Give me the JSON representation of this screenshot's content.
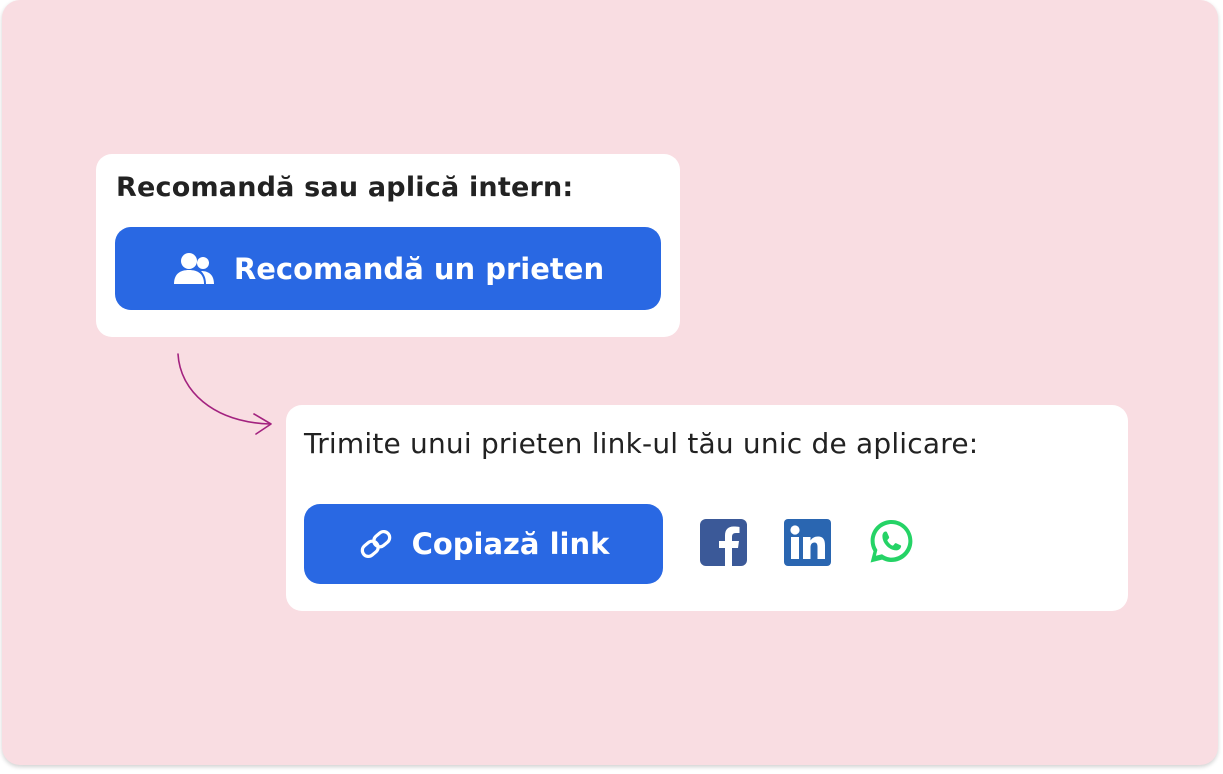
{
  "referral_card": {
    "heading": "Recomandă sau aplică intern:",
    "button_label": "Recomandă un prieten",
    "button_icon": "users-icon"
  },
  "share_card": {
    "heading": "Trimite unui prieten link-ul tău unic de aplicare:",
    "copy_button_label": "Copiază link",
    "copy_button_icon": "link-icon",
    "social_icons": [
      "facebook-icon",
      "linkedin-icon",
      "whatsapp-icon"
    ]
  },
  "colors": {
    "background": "#f9dde2",
    "card": "#ffffff",
    "button": "#2968e3",
    "arrow": "#a3227f",
    "facebook": "#3b5998",
    "linkedin": "#2a66b1",
    "whatsapp": "#25d366"
  }
}
